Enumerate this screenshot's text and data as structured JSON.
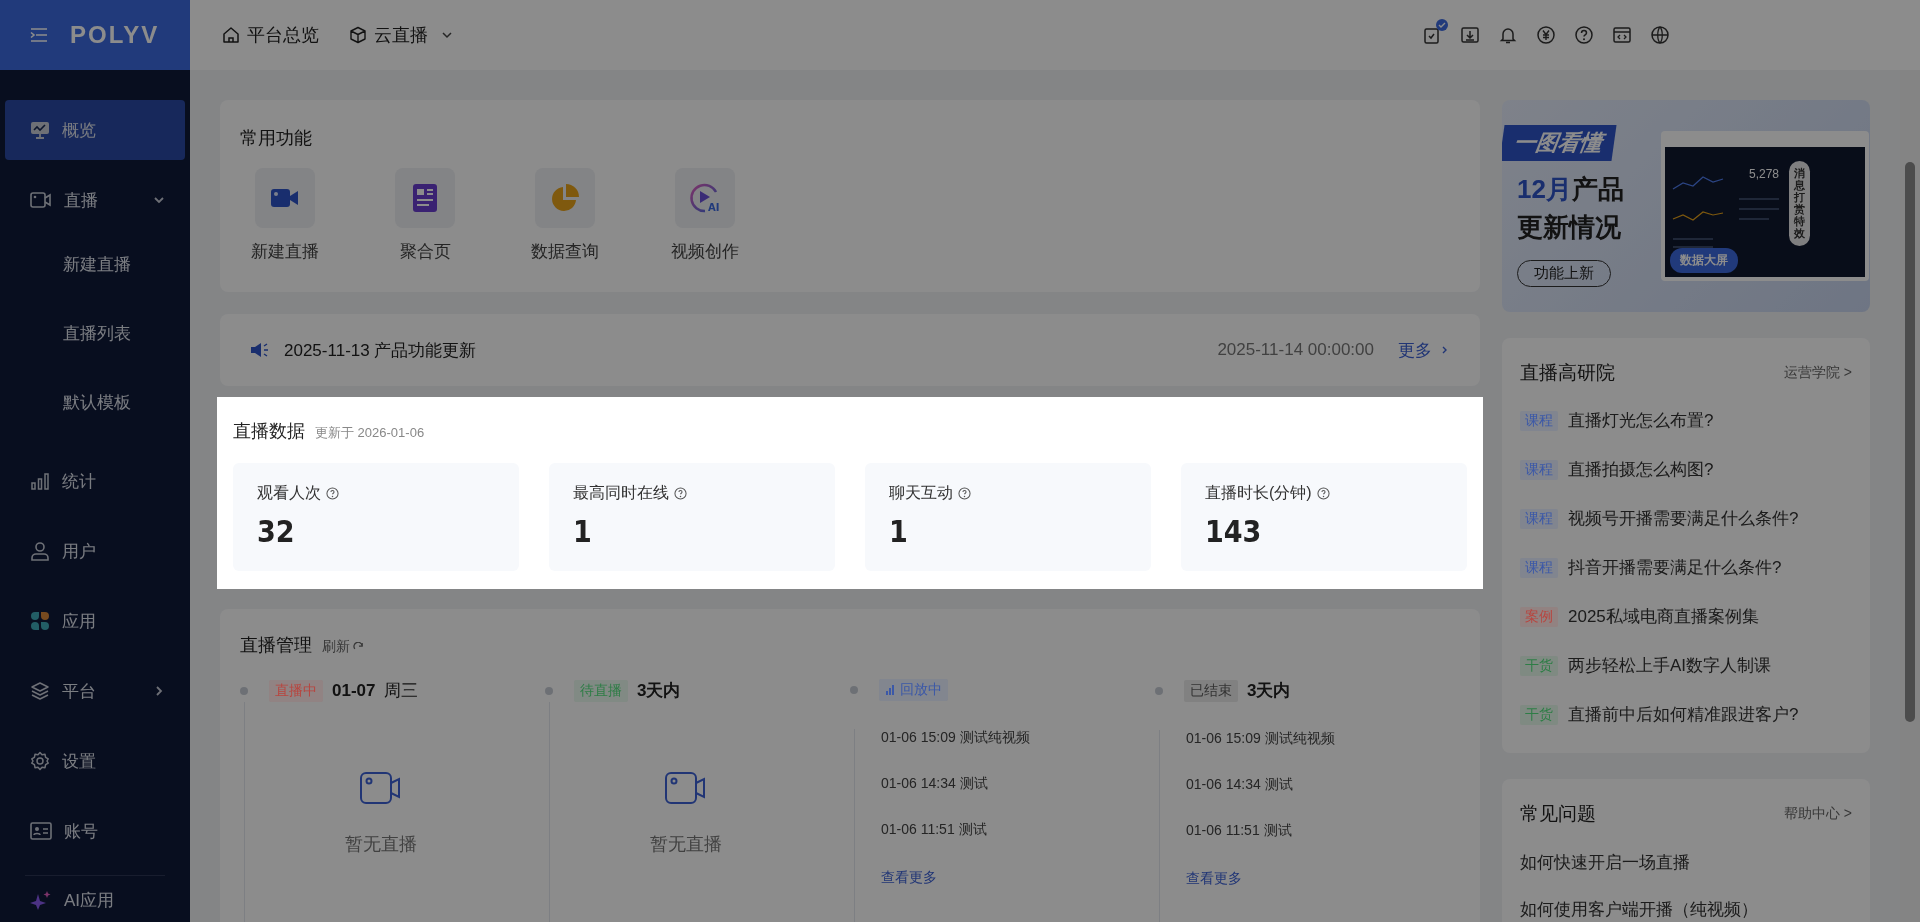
{
  "sidebar": {
    "logo": "POLYV",
    "items": [
      {
        "label": "概览",
        "selected": true
      },
      {
        "label": "直播",
        "selected": false,
        "expanded": true,
        "children": [
          {
            "label": "新建直播",
            "selected": false
          },
          {
            "label": "直播列表",
            "selected": false
          },
          {
            "label": "默认模板",
            "selected": false
          }
        ]
      },
      {
        "label": "统计",
        "selected": false
      },
      {
        "label": "用户",
        "selected": false
      },
      {
        "label": "应用",
        "selected": false
      },
      {
        "label": "平台",
        "selected": false,
        "expanded": false
      },
      {
        "label": "设置",
        "selected": false
      },
      {
        "label": "账号",
        "selected": false
      },
      {
        "label": "AI应用",
        "selected": false
      }
    ]
  },
  "topbar": {
    "nav": [
      {
        "label": "平台总览",
        "dropdown": false
      },
      {
        "label": "云直播",
        "dropdown": true
      }
    ]
  },
  "common": {
    "title": "常用功能",
    "items": [
      "新建直播",
      "聚合页",
      "数据查询",
      "视频创作"
    ],
    "ai_label": "AI"
  },
  "notice": {
    "title": "2025-11-13 产品功能更新",
    "date": "2025-11-14 00:00:00",
    "more": "更多"
  },
  "stats": {
    "title": "直播数据",
    "updated": "更新于 2026-01-06",
    "cards": [
      {
        "label": "观看人次",
        "value": "32"
      },
      {
        "label": "最高同时在线",
        "value": "1"
      },
      {
        "label": "聊天互动",
        "value": "1"
      },
      {
        "label": "直播时长(分钟)",
        "value": "143"
      }
    ]
  },
  "manage": {
    "title": "直播管理",
    "refresh": "刷新",
    "columns": [
      {
        "kind": "empty",
        "tag": "直播中",
        "color": "#b8453f",
        "heading": "01-07",
        "heading_extra": "周三",
        "empty": "暂无直播"
      },
      {
        "kind": "empty",
        "tag": "待直播",
        "color": "#2e7d46",
        "heading": "3天内",
        "empty": "暂无直播"
      },
      {
        "kind": "list",
        "tag": "回放中",
        "color": "#3b58a8",
        "items": [
          "01-06 15:09 测试纯视频",
          "01-06 14:34 测试",
          "01-06 11:51 测试"
        ],
        "more": "查看更多"
      },
      {
        "kind": "list",
        "tag": "已结束",
        "color": "#333333",
        "heading": "3天内",
        "items": [
          "01-06 15:09 测试纯视频",
          "01-06 14:34 测试",
          "01-06 11:51 测试"
        ],
        "more": "查看更多"
      }
    ]
  },
  "banner": {
    "ribbon": "一图看懂",
    "headline": [
      {
        "text": "12月",
        "accent": true
      },
      {
        "text": "产品",
        "accent": false
      }
    ],
    "subline": "更新情况",
    "button": "功能上新",
    "screen_value": "5,278",
    "bubble": "消息打赏特效",
    "screen_button": "数据大屏"
  },
  "research": {
    "title": "直播高研院",
    "link": "运营学院 >",
    "items": [
      {
        "tag": "课程",
        "color": "#3b58a8",
        "text": "直播灯光怎么布置?"
      },
      {
        "tag": "课程",
        "color": "#3b58a8",
        "text": "直播拍摄怎么构图?"
      },
      {
        "tag": "课程",
        "color": "#3b58a8",
        "text": "视频号开播需要满足什么条件?"
      },
      {
        "tag": "课程",
        "color": "#3b58a8",
        "text": "抖音开播需要满足什么条件?"
      },
      {
        "tag": "案例",
        "color": "#b8453f",
        "text": "2025私域电商直播案例集"
      },
      {
        "tag": "干货",
        "color": "#2e7d46",
        "text": "两步轻松上手AI数字人制课"
      },
      {
        "tag": "干货",
        "color": "#2e7d46",
        "text": "直播前中后如何精准跟进客户?"
      }
    ]
  },
  "faq": {
    "title": "常见问题",
    "link": "帮助中心 >",
    "items": [
      "如何快速开启一场直播",
      "如何使用客户端开播（纯视频）"
    ]
  }
}
